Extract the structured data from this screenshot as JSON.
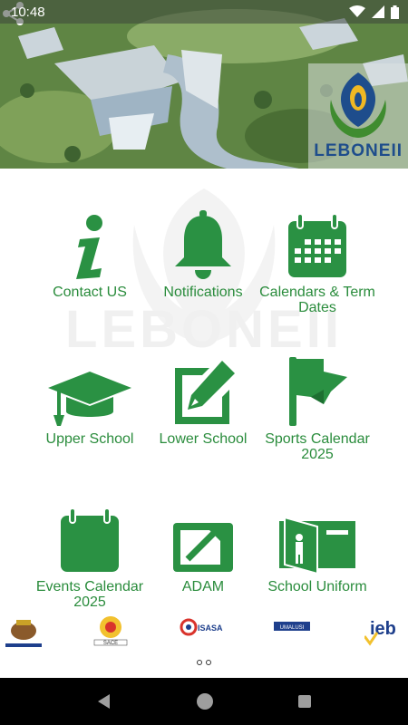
{
  "status_bar": {
    "time": "10:48"
  },
  "header": {
    "logo_text": "LEBONEII"
  },
  "watermark": {
    "text": "LEBONEII"
  },
  "tiles": [
    {
      "label": "Contact US",
      "icon": "info-icon"
    },
    {
      "label": "Notifications",
      "icon": "bell-icon"
    },
    {
      "label": "Calendars & Term Dates",
      "icon": "calendar-grid-icon"
    },
    {
      "label": "Upper School",
      "icon": "graduation-cap-icon"
    },
    {
      "label": "Lower School",
      "icon": "pencil-edit-icon"
    },
    {
      "label": "Sports Calendar 2025",
      "icon": "flag-icon"
    },
    {
      "label": "Events Calendar 2025",
      "icon": "calendar-icon"
    },
    {
      "label": "ADAM",
      "icon": "external-link-icon"
    },
    {
      "label": "School Uniform",
      "icon": "door-person-icon"
    }
  ],
  "partners": [
    {
      "name": "ROYAL BAFOKENG NATION"
    },
    {
      "name": "SACE"
    },
    {
      "name": "ISASA"
    },
    {
      "name": "UMALUSI"
    },
    {
      "name": "ieb"
    }
  ],
  "pager": {
    "pages": 2,
    "active": 1
  },
  "colors": {
    "accent": "#2a9143",
    "nav_bar": "#000000"
  }
}
